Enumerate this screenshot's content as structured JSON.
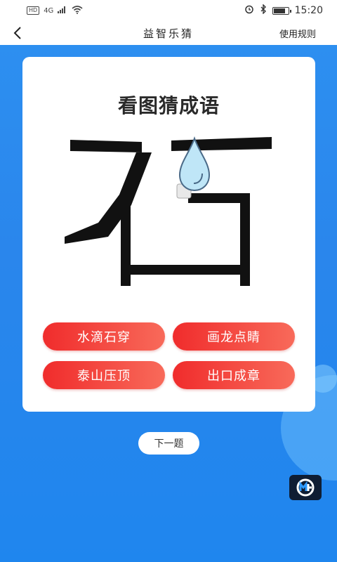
{
  "status_bar": {
    "network": "4G",
    "hd_label": "HD",
    "time": "15:20",
    "battery_level": 0.85
  },
  "nav": {
    "title": "益智乐猜",
    "rules_label": "使用规则"
  },
  "card": {
    "title": "看图猜成语",
    "options": [
      "水滴石穿",
      "画龙点睛",
      "泰山压顶",
      "出口成章"
    ]
  },
  "next_label": "下一题",
  "colors": {
    "primary_blue": "#2a86ec",
    "option_red": "#f02c2c",
    "option_red_light": "#f86a5a"
  }
}
